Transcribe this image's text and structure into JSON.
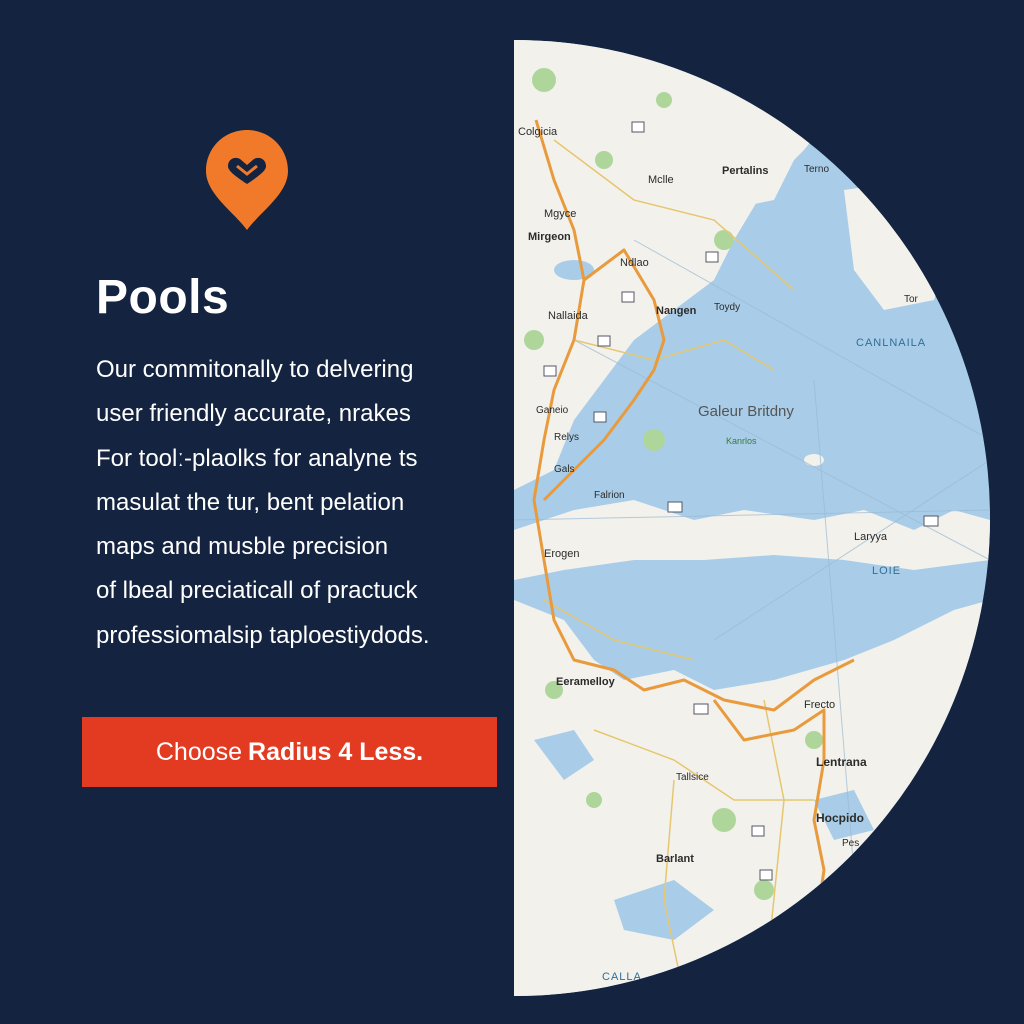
{
  "brand": {
    "accent": "#f07a2a",
    "background": "#14233f",
    "cta_color": "#e33b22"
  },
  "pin_icon": "map-pin-heart-icon",
  "title": "Pools",
  "body_lines": [
    "Our commitonally to delvering",
    "user friendly accurate, nrakes",
    "For toolː-plaolks for analyne ts",
    "masulat the tur, bent pelation",
    "maps and musble precision",
    "of lbeal preciaticall of practuck",
    "professiomalsip taploestiydods."
  ],
  "cta": {
    "light": "Choose",
    "bold": "Radius 4 Less."
  },
  "map": {
    "labels": {
      "l1": "Colgicia",
      "l2": "Mclle",
      "l3": "Pertalins",
      "l4": "Terno",
      "l5": "Mgyce",
      "l6": "Mirgeon",
      "l7": "Ndlao",
      "l8": "Nallaida",
      "l9": "Nangen",
      "l10": "Toydy",
      "l11": "Tor",
      "l12": "CANLNAILA",
      "l13": "Ganeio",
      "l14": "Galeur Britdny",
      "l15": "Relys",
      "l16": "Kanrlos",
      "l17": "Gals",
      "l18": "Falrion",
      "l19": "Laryya",
      "l20": "Erogen",
      "l21": "LOIE",
      "l22": "Eeramelloy",
      "l23": "Frecto",
      "l24": "Lentrana",
      "l25": "Tallsice",
      "l26": "Hocpido",
      "l27": "Barlant",
      "l28": "Pes",
      "l29": "CALLA"
    }
  }
}
